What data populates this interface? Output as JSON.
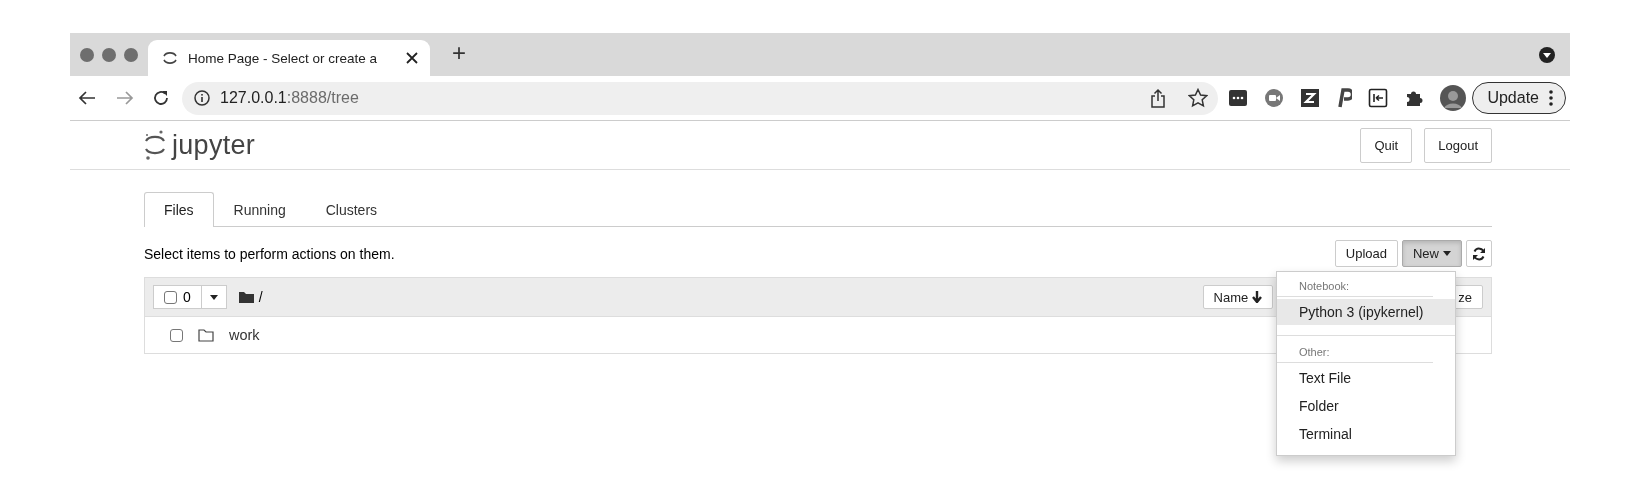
{
  "browser": {
    "tab": {
      "title": "Home Page - Select or create a",
      "selected": true
    },
    "address": {
      "host": "127.0.0.1",
      "path": ":8888/tree"
    },
    "new_tab_button": "+",
    "update_button": "Update"
  },
  "header": {
    "logo_text": "jupyter",
    "buttons": [
      "Quit",
      "Logout"
    ]
  },
  "tabs": [
    {
      "label": "Files",
      "selected": true
    },
    {
      "label": "Running",
      "selected": false
    },
    {
      "label": "Clusters",
      "selected": false
    }
  ],
  "hint": "Select items to perform actions on them.",
  "toolbar": {
    "upload": "Upload",
    "new": {
      "label": "New",
      "expanded": true
    }
  },
  "list_header": {
    "selected_count": "0",
    "select_all_checked": false,
    "breadcrumb": "/",
    "sort_buttons": [
      "Name",
      "ze"
    ]
  },
  "rows": [
    {
      "name": "work",
      "kind": "folder",
      "checked": false
    }
  ],
  "new_menu": [
    {
      "header": "Notebook:",
      "items": [
        {
          "label": "Python 3 (ipykernel)",
          "selected": true
        }
      ]
    },
    {
      "header": "Other:",
      "items": [
        {
          "label": "Text File",
          "selected": false
        },
        {
          "label": "Folder",
          "selected": false
        },
        {
          "label": "Terminal",
          "selected": false
        }
      ]
    }
  ]
}
